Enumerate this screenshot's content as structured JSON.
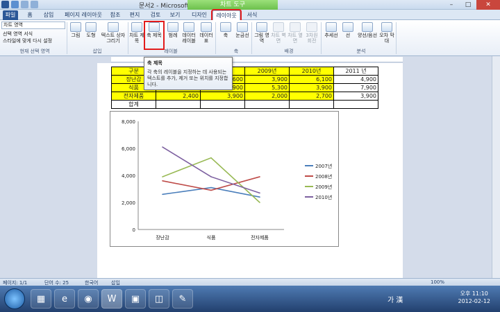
{
  "titlebar": {
    "title": "문서2 - Microsoft Word",
    "context_tab": "차트 도구",
    "minimize": "–",
    "maximize": "□",
    "close": "✕"
  },
  "tabs": {
    "file": "파일",
    "items": [
      "홈",
      "삽입",
      "페이지 레이아웃",
      "참조",
      "편지",
      "검토",
      "보기",
      "디자인",
      "레이아웃",
      "서식"
    ],
    "active": "레이아웃"
  },
  "ribbon": {
    "selection_box": "차트 영역",
    "select_format": "선택 영역 서식",
    "reset_style": "스타일에 맞게 다시 설정",
    "groups": {
      "current_selection": "현재 선택 영역",
      "insert": "삽입",
      "labels": "레이블",
      "axes": "축",
      "background": "배경",
      "analysis": "분석"
    },
    "buttons": {
      "picture": "그림",
      "shapes": "도형",
      "textbox": "텍스트 상자 그리기",
      "chart_title": "차트 제목",
      "axis_title": "축 제목",
      "legend": "범례",
      "data_labels": "데이터 레이블",
      "data_table": "데이터 표",
      "axes": "축",
      "gridlines": "눈금선",
      "plot_area": "그림 영역",
      "chart_wall": "차트 벽면",
      "chart_floor": "차트 옆면",
      "rotation_3d": "3차원 회전",
      "trendline": "추세선",
      "lines": "선",
      "updown_bars": "양선/음선",
      "error_bars": "오차 막대"
    }
  },
  "tooltip": {
    "title": "축 제목",
    "body": "각 축의 레이블을 지정하는 데 사용되는 텍스트를 추가, 제거 또는 위치를 지정합니다."
  },
  "table": {
    "header": [
      "구분",
      "",
      "",
      "2009년",
      "2010년",
      "2011 년"
    ],
    "rows": [
      [
        "장난감",
        "",
        "3,600",
        "3,900",
        "6,100",
        "4,900"
      ],
      [
        "식품",
        "3,700",
        "2,900",
        "5,300",
        "3,900",
        "7,900"
      ],
      [
        "전자제품",
        "2,400",
        "3,900",
        "2,000",
        "2,700",
        "3,900"
      ],
      [
        "합계",
        "",
        "",
        "",
        "",
        ""
      ]
    ]
  },
  "chart_data": {
    "type": "line",
    "categories": [
      "장난감",
      "식품",
      "전자제품"
    ],
    "series": [
      {
        "name": "2007년",
        "values": [
          2600,
          3100,
          2400
        ],
        "color": "#4a7ebb"
      },
      {
        "name": "2008년",
        "values": [
          3600,
          2900,
          3900
        ],
        "color": "#be4b48"
      },
      {
        "name": "2009년",
        "values": [
          3900,
          5300,
          2000
        ],
        "color": "#98b954"
      },
      {
        "name": "2010년",
        "values": [
          6100,
          3900,
          2700
        ],
        "color": "#7d60a0"
      }
    ],
    "yticks": [
      "0",
      "2,000",
      "4,000",
      "6,000",
      "8,000"
    ],
    "ylim": [
      0,
      8000
    ],
    "legend": "right",
    "grid": false
  },
  "statusbar": {
    "page": "페이지: 1/1",
    "words": "단어 수: 25",
    "lang": "한국어",
    "mode": "삽입",
    "zoom": "100%"
  },
  "taskbar": {
    "ime": "가 漢",
    "time": "오후 11:10",
    "date": "2012-02-12"
  }
}
